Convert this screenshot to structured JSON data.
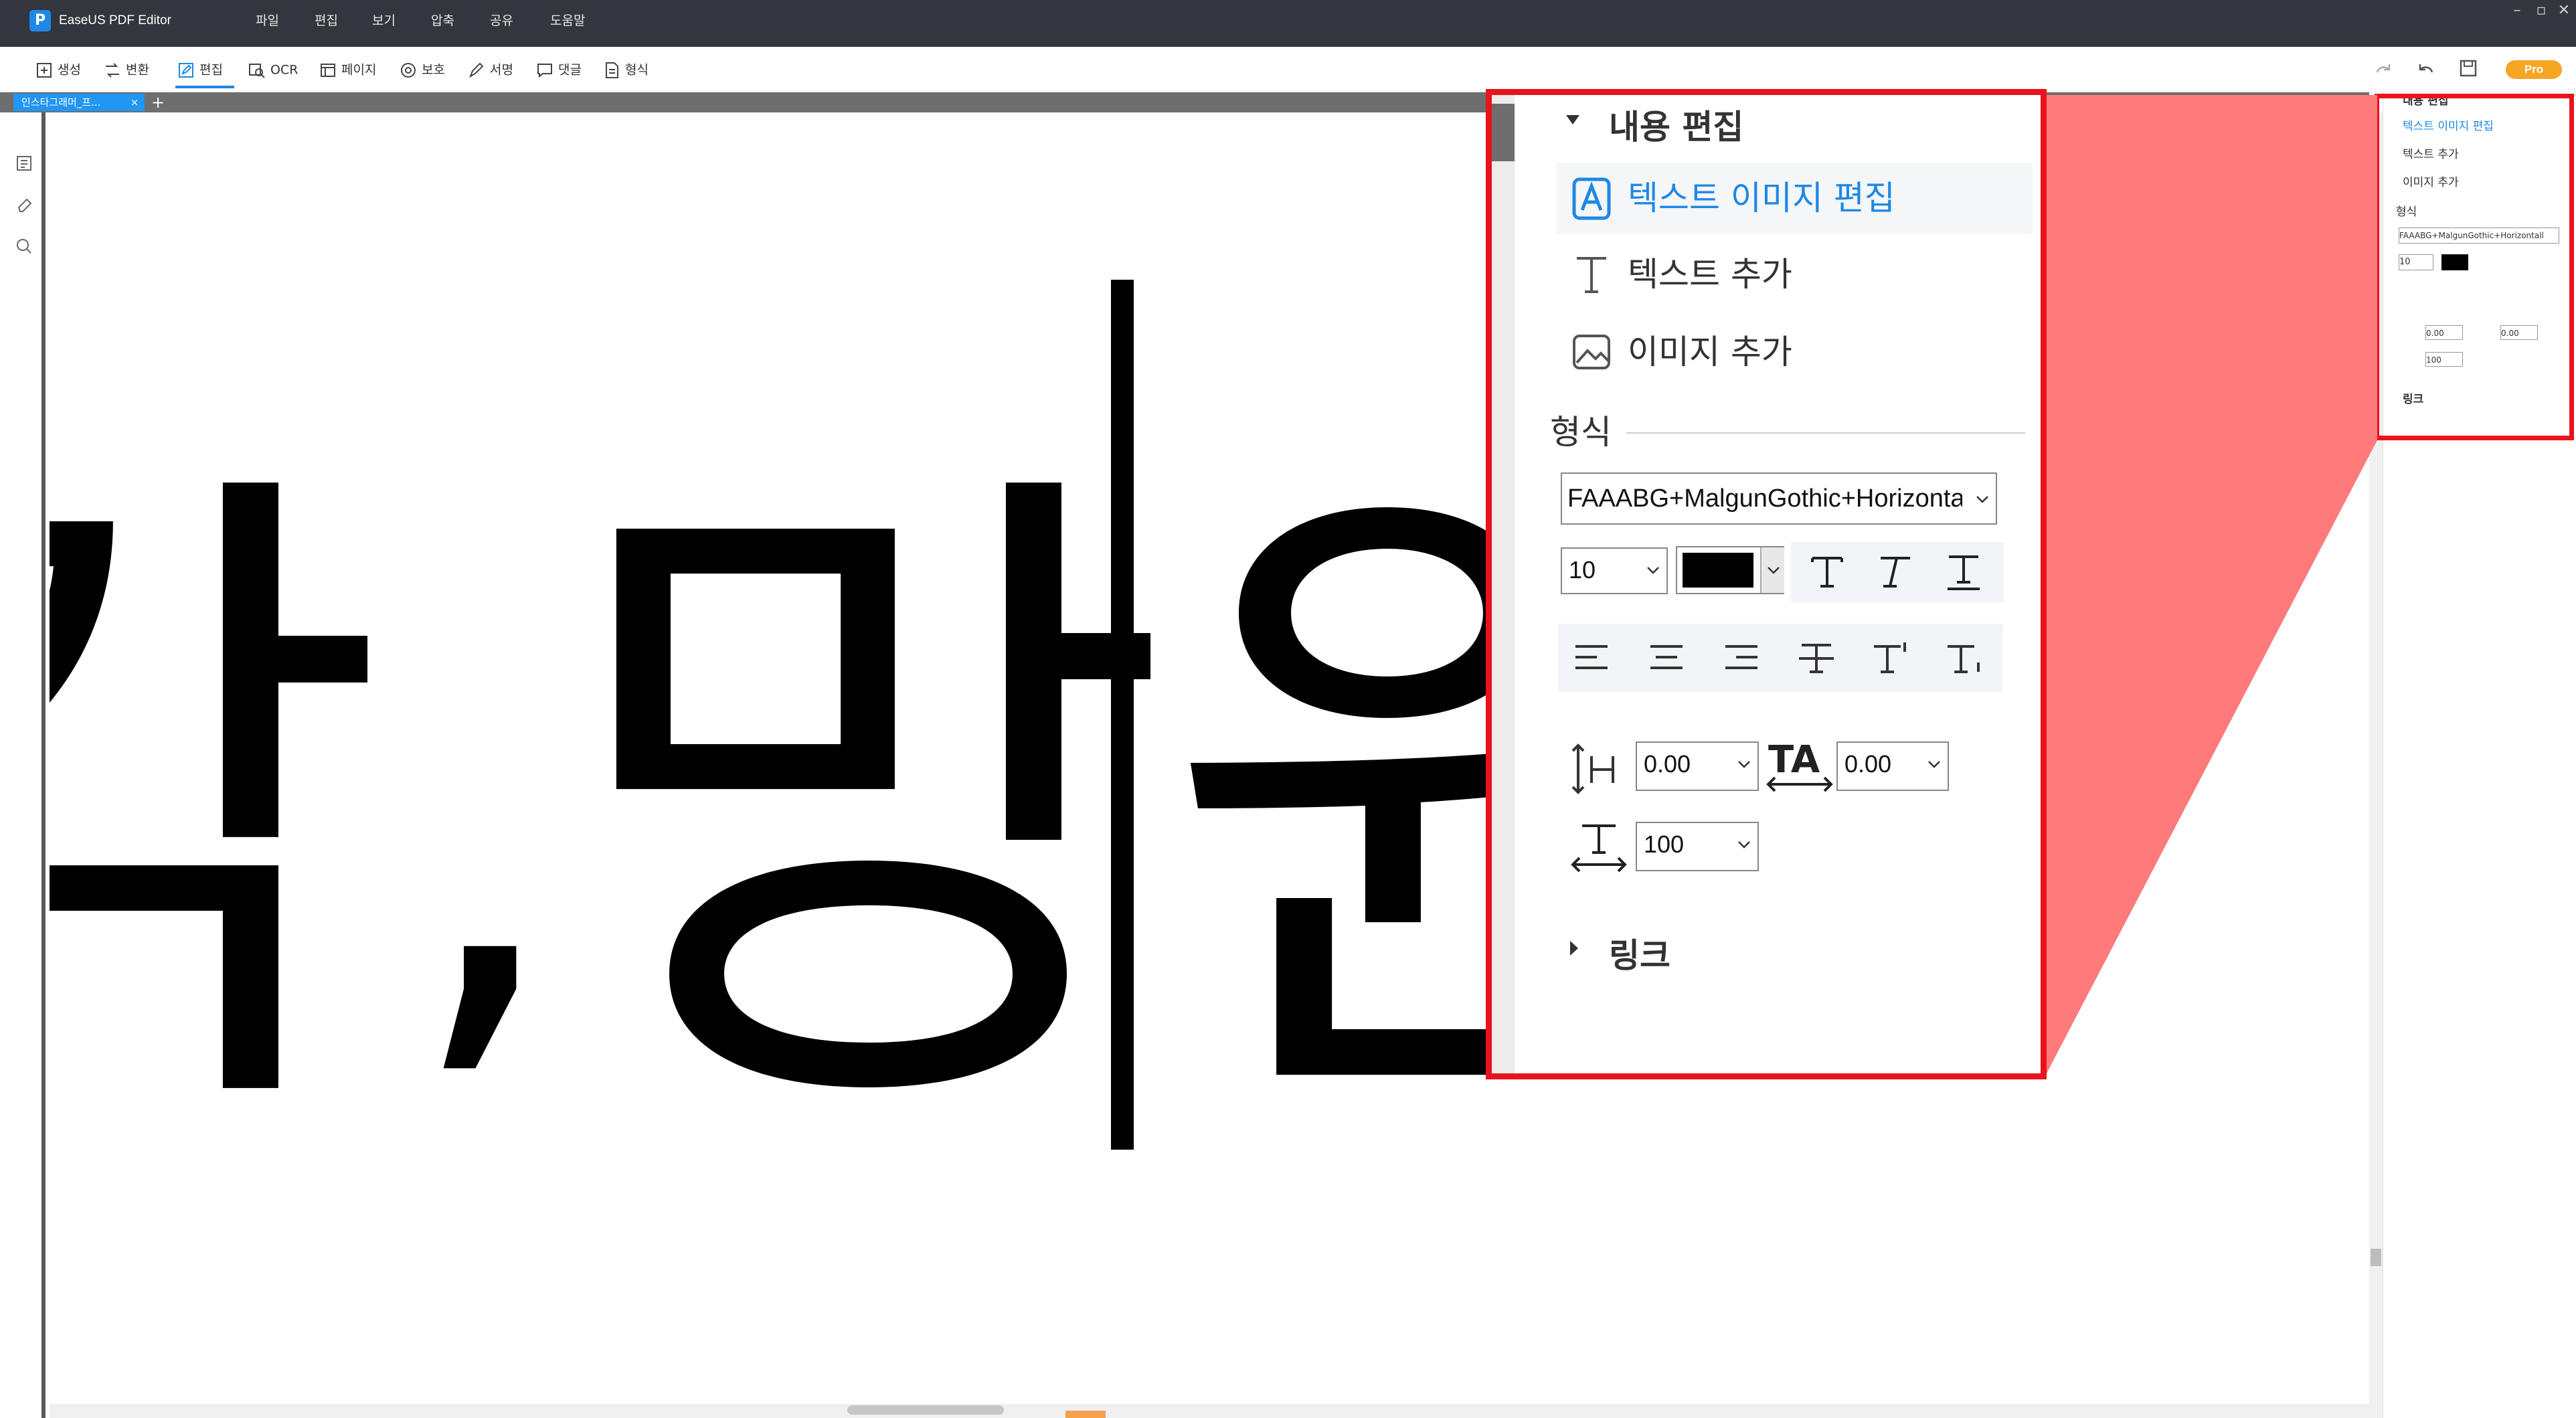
{
  "app": {
    "title": "EaseUS PDF Editor",
    "logo_letter": "P"
  },
  "menu": [
    "파일",
    "편집",
    "보기",
    "압축",
    "공유",
    "도움말"
  ],
  "toolbar": {
    "create": "생성",
    "convert": "변환",
    "edit": "편집",
    "ocr": "OCR",
    "page": "페이지",
    "protect": "보호",
    "sign": "서명",
    "comment": "댓글",
    "form": "형식",
    "pro_badge": "Pro"
  },
  "tab": {
    "label": "인스타그래머_프...",
    "close": "×",
    "add": "+"
  },
  "panel": {
    "content_edit": "내용 편집",
    "edit_text_image": "텍스트 이미지 편집",
    "add_text": "텍스트 추가",
    "add_image": "이미지 추가",
    "format_heading": "형식",
    "font_family": "FAAABG+MalgunGothic+Horizontall",
    "font_size": "10",
    "line_spacing": "0.00",
    "char_spacing": "0.00",
    "horizontal_scale": "100",
    "link": "링크"
  },
  "document": {
    "glyphs": [
      "각",
      ",",
      "망",
      "원"
    ]
  },
  "colors": {
    "accent": "#1e88e5",
    "highlight": "#e8131b",
    "zoom_cone": "#ff7b7b",
    "pro": "#f5a623",
    "titlebar": "#33363d"
  }
}
